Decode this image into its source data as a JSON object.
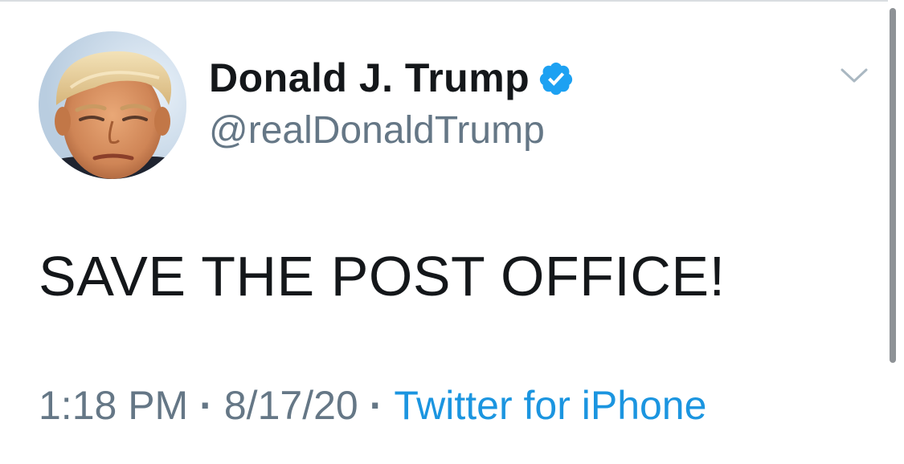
{
  "tweet": {
    "author": {
      "display_name": "Donald J. Trump",
      "handle": "@realDonaldTrump",
      "verified": true,
      "verified_icon": "verified-badge-icon",
      "avatar": "profile-photo"
    },
    "text": "SAVE THE POST OFFICE!",
    "time": "1:18 PM",
    "separator": "·",
    "date": "8/17/20",
    "source": "Twitter for iPhone",
    "menu_icon": "chevron-down-icon"
  },
  "colors": {
    "text_primary": "#14171a",
    "text_secondary": "#657786",
    "link": "#1b95e0",
    "verified": "#1da1f2"
  }
}
